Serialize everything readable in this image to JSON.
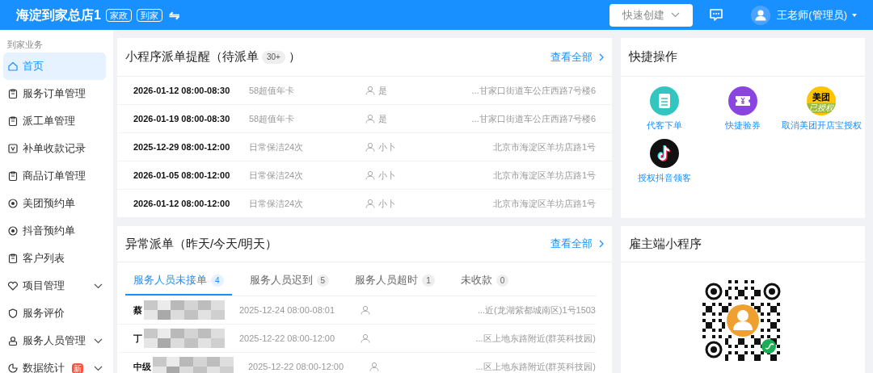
{
  "header": {
    "store_name": "海淀到家总店1",
    "tags": [
      "家政",
      "到家"
    ],
    "switch_icon": "⇋",
    "quick_create": "快速创建",
    "user_name": "王老师(管理员)"
  },
  "sidebar": {
    "section_title": "到家业务",
    "items": [
      {
        "label": "首页",
        "selected": true,
        "expandable": false
      },
      {
        "label": "服务订单管理",
        "selected": false,
        "expandable": false
      },
      {
        "label": "派工单管理",
        "selected": false,
        "expandable": false
      },
      {
        "label": "补单收款记录",
        "selected": false,
        "expandable": false
      },
      {
        "label": "商品订单管理",
        "selected": false,
        "expandable": false
      },
      {
        "label": "美团预约单",
        "selected": false,
        "expandable": false
      },
      {
        "label": "抖音预约单",
        "selected": false,
        "expandable": false
      },
      {
        "label": "客户列表",
        "selected": false,
        "expandable": false
      },
      {
        "label": "项目管理",
        "selected": false,
        "expandable": true
      },
      {
        "label": "服务评价",
        "selected": false,
        "expandable": false
      },
      {
        "label": "服务人员管理",
        "selected": false,
        "expandable": true
      },
      {
        "label": "数据统计",
        "selected": false,
        "expandable": true,
        "badge": "新"
      }
    ]
  },
  "dispatch_reminder": {
    "title": "小程序派单提醒（待派单",
    "count": "30+",
    "title_end": "）",
    "view_all": "查看全部",
    "rows": [
      {
        "time": "2026-01-12 08:00-08:30",
        "service": "58超值年卡",
        "staff": "是",
        "address": "...甘家口街道车公庄西路7号楼6"
      },
      {
        "time": "2026-01-19 08:00-08:30",
        "service": "58超值年卡",
        "staff": "是",
        "address": "...甘家口街道车公庄西路7号楼6"
      },
      {
        "time": "2025-12-29 08:00-12:00",
        "service": "日常保洁24次",
        "staff": "小卜",
        "address": "北京市海淀区羊坊店路1号"
      },
      {
        "time": "2026-01-05 08:00-12:00",
        "service": "日常保洁24次",
        "staff": "小卜",
        "address": "北京市海淀区羊坊店路1号"
      },
      {
        "time": "2026-01-12 08:00-12:00",
        "service": "日常保洁24次",
        "staff": "小卜",
        "address": "北京市海淀区羊坊店路1号"
      }
    ]
  },
  "quick_actions": {
    "title": "快捷操作",
    "items": [
      {
        "label": "代客下单",
        "kind": "clipboard"
      },
      {
        "label": "快捷验券",
        "kind": "ticket"
      },
      {
        "label": "取消美团开店宝授权",
        "kind": "meituan",
        "logo_text": "美团",
        "logo_sub": "已授权"
      },
      {
        "label": "授权抖音领客",
        "kind": "tiktok"
      }
    ]
  },
  "abnormal_dispatch": {
    "title": "异常派单（昨天/今天/明天）",
    "view_all": "查看全部",
    "tabs": [
      {
        "label": "服务人员未接单",
        "count": "4",
        "selected": true
      },
      {
        "label": "服务人员迟到",
        "count": "5",
        "selected": false
      },
      {
        "label": "服务人员超时",
        "count": "1",
        "selected": false
      },
      {
        "label": "未收款",
        "count": "0",
        "selected": false
      }
    ],
    "rows": [
      {
        "name": "蔡",
        "time": "2025-12-24 08:00-08:01",
        "address": "...近(龙湖紫都城南区)1号1503"
      },
      {
        "name": "丁",
        "time": "2025-12-22 08:00-12:00",
        "address": "...区上地东路附近(群英科技园)"
      },
      {
        "name": "中级",
        "time": "2025-12-22 08:00-12:00",
        "address": "...区上地东路附近(群英科技园)"
      }
    ]
  },
  "mini_program": {
    "title": "雇主端小程序"
  }
}
